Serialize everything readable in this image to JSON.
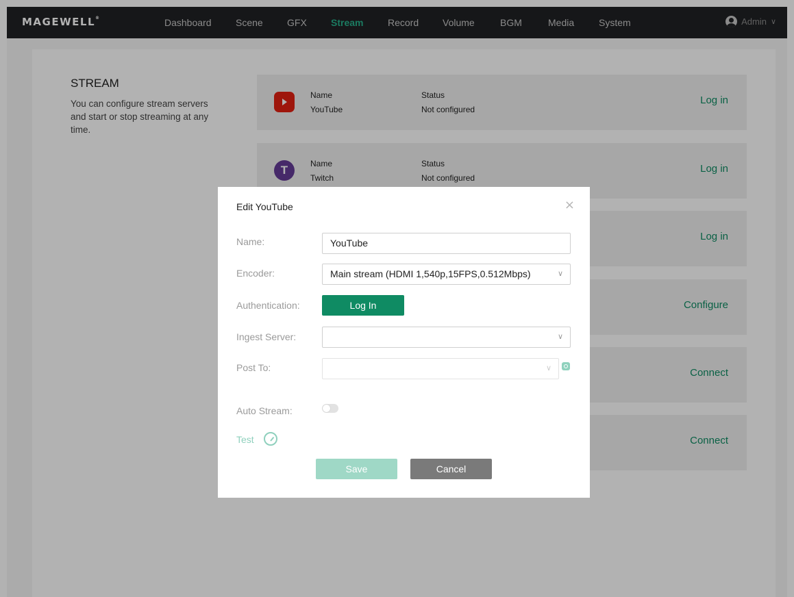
{
  "header": {
    "logo": "MAGEWELL",
    "logo_mark": "®",
    "nav": [
      {
        "label": "Dashboard",
        "active": false
      },
      {
        "label": "Scene",
        "active": false
      },
      {
        "label": "GFX",
        "active": false
      },
      {
        "label": "Stream",
        "active": true
      },
      {
        "label": "Record",
        "active": false
      },
      {
        "label": "Volume",
        "active": false
      },
      {
        "label": "BGM",
        "active": false
      },
      {
        "label": "Media",
        "active": false
      },
      {
        "label": "System",
        "active": false
      }
    ],
    "user": {
      "label": "Admin",
      "caret": "∨"
    }
  },
  "section": {
    "title": "STREAM",
    "description": "You can configure stream servers and start or stop streaming at any time."
  },
  "cards": [
    {
      "name_label": "Name",
      "name": "YouTube",
      "status_label": "Status",
      "status": "Not configured",
      "action": "Log in",
      "icon": "youtube-icon",
      "icon_text": ""
    },
    {
      "name_label": "Name",
      "name": "Twitch",
      "status_label": "Status",
      "status": "Not configured",
      "action": "Log in",
      "icon": "twitch-icon",
      "icon_text": "T"
    },
    {
      "action": "Log in"
    },
    {
      "action": "Configure"
    },
    {
      "action": "Connect"
    },
    {
      "action": "Connect"
    }
  ],
  "modal": {
    "title": "Edit YouTube",
    "close": "×",
    "name_label": "Name:",
    "name_value": "YouTube",
    "encoder_label": "Encoder:",
    "encoder_value": "Main stream (HDMI 1,540p,15FPS,0.512Mbps)",
    "auth_label": "Authentication:",
    "login_button": "Log In",
    "ingest_label": "Ingest Server:",
    "ingest_value": "",
    "post_label": "Post To:",
    "post_value": "",
    "auto_label": "Auto Stream:",
    "auto_on": false,
    "test_label": "Test",
    "save": "Save",
    "cancel": "Cancel",
    "chevron": "∨"
  },
  "colors": {
    "accent": "#0f8b63",
    "topbar": "#202124"
  }
}
